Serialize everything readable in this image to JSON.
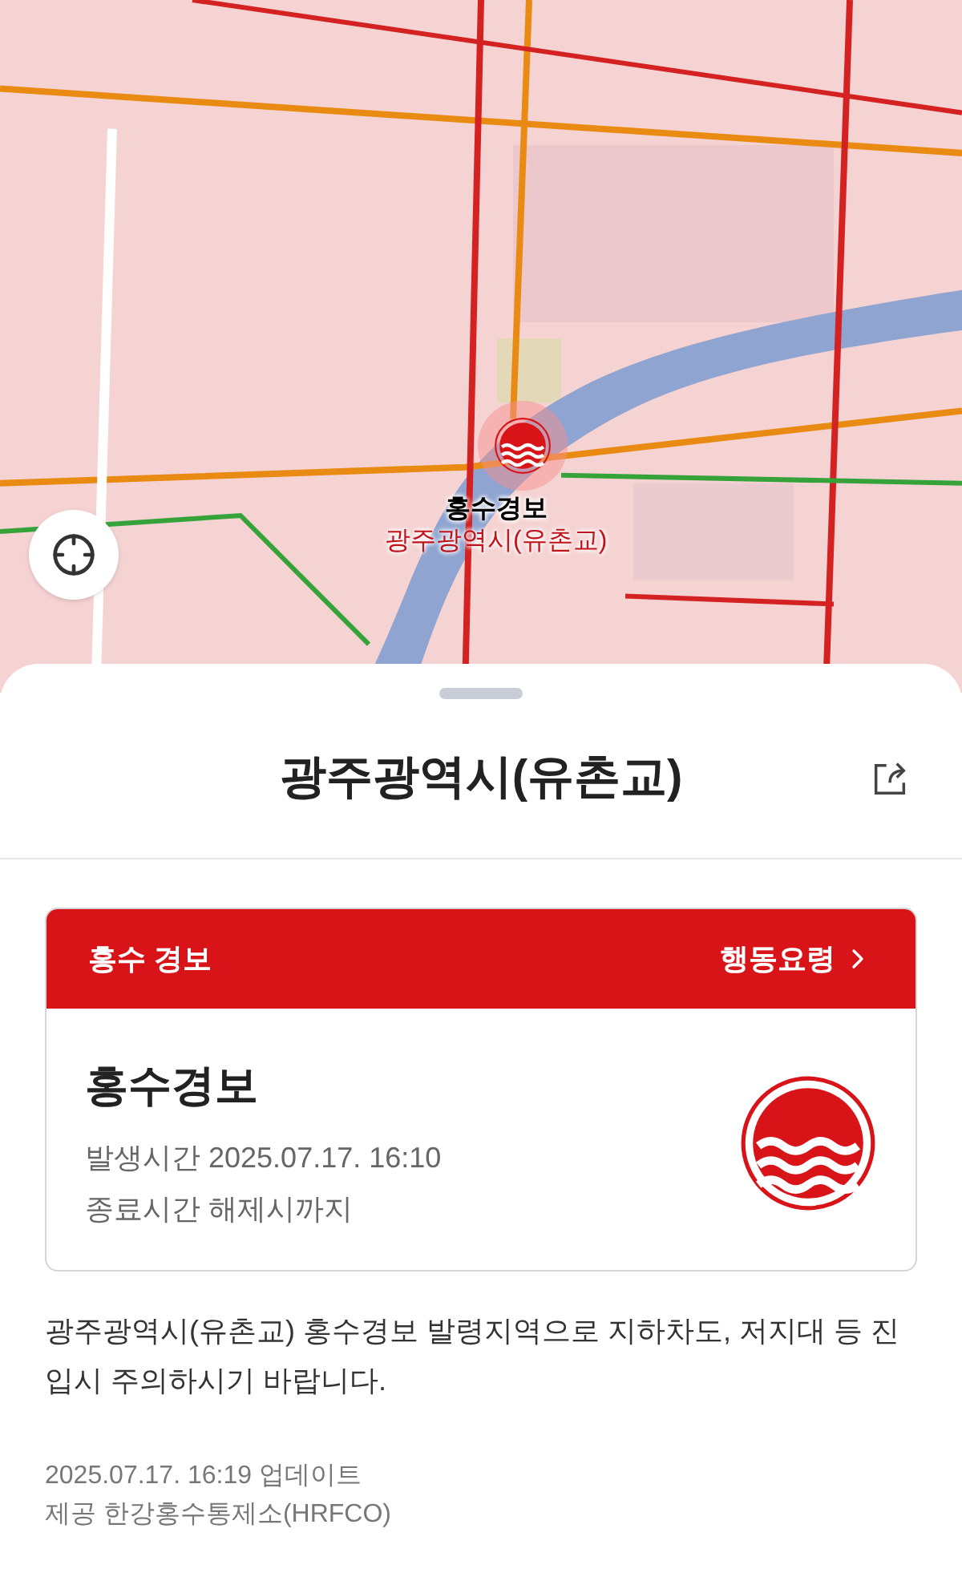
{
  "map": {
    "marker": {
      "kind": "flood",
      "title": "홍수경보",
      "subtitle": "광주광역시(유촌교)"
    }
  },
  "sheet": {
    "title": "광주광역시(유촌교)"
  },
  "alert": {
    "kind": "warning",
    "header": "홍수 경보",
    "action": "행동요령",
    "title": "홍수경보",
    "lines": [
      {
        "label": "발생시간",
        "value": "2025.07.17. 16:10"
      },
      {
        "label": "종료시간",
        "value": "해제시까지"
      }
    ]
  },
  "description": "광주광역시(유촌교) 홍수경보 발령지역으로 지하차도, 저지대 등 진입시 주의하시기 바랍니다.",
  "updated": "2025.07.17. 16:19 업데이트",
  "provider": "제공 한강홍수통제소(HRFCO)"
}
